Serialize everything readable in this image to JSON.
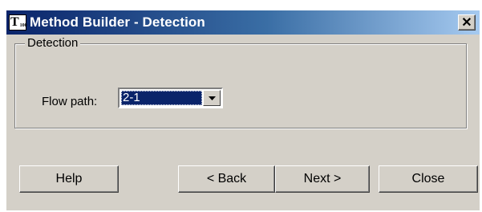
{
  "window": {
    "title": "Method Builder - Detection",
    "icon_text": "T",
    "icon_subtext": "100",
    "close_glyph": "✕"
  },
  "detection": {
    "group_label": "Detection",
    "flow_path_label": "Flow path:",
    "flow_path_value": "2-1"
  },
  "buttons": {
    "help": "Help",
    "back": "< Back",
    "next": "Next >",
    "close": "Close"
  },
  "colors": {
    "titlebar_start": "#0a246a",
    "titlebar_end": "#a6caf0",
    "face": "#d4d0c8",
    "selection": "#0a246a"
  }
}
